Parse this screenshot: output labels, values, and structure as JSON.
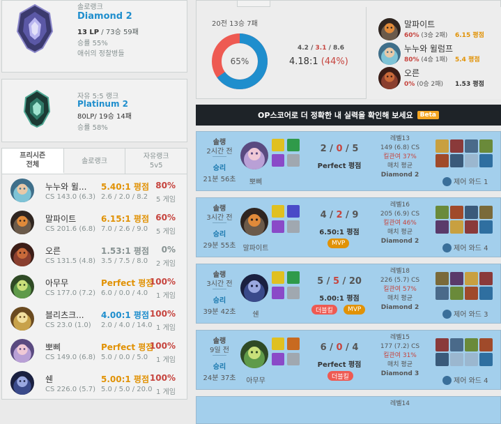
{
  "solo_rank": {
    "queue": "솔로랭크",
    "tier": "Diamond 2",
    "lp": "13 LP",
    "record": "/ 73승 59패",
    "winrate": "승률 55%",
    "league": "애쉬의 정찰병들"
  },
  "flex_rank": {
    "queue": "자유 5:5 랭크",
    "tier": "Platinum 2",
    "record": "80LP/ 19승 14패",
    "winrate": "승률 58%"
  },
  "tabs": [
    {
      "label": "프리시즌\n전체"
    },
    {
      "label": "솔로랭크"
    },
    {
      "label": "자유랭크\n5v5"
    }
  ],
  "champions": [
    {
      "name": "누누와 윌...",
      "cs": "CS 143.0 (6.3)",
      "kda": "5.40:1 평점",
      "kda_detail": "2.6 / 2.0 / 8.2",
      "winrate": "80%",
      "games": "5 게임",
      "kda_color": "#e19205",
      "wr_color": "#c6443e"
    },
    {
      "name": "말파이트",
      "cs": "CS 201.6 (6.8)",
      "kda": "6.15:1 평점",
      "kda_detail": "7.0 / 2.6 / 9.0",
      "winrate": "60%",
      "games": "5 게임",
      "kda_color": "#e19205",
      "wr_color": "#c6443e"
    },
    {
      "name": "오른",
      "cs": "CS 131.5 (4.8)",
      "kda": "1.53:1 평점",
      "kda_detail": "3.5 / 7.5 / 8.0",
      "winrate": "0%",
      "games": "2 게임",
      "kda_color": "#879292",
      "wr_color": "#879292"
    },
    {
      "name": "아무무",
      "cs": "CS 177.0 (7.2)",
      "kda": "Perfect 평점",
      "kda_detail": "6.0 / 0.0 / 4.0",
      "winrate": "100%",
      "games": "1 게임",
      "kda_color": "#e19205",
      "wr_color": "#c6443e"
    },
    {
      "name": "블리츠크...",
      "cs": "CS 23.0 (1.0)",
      "kda": "4.00:1 평점",
      "kda_detail": "2.0 / 4.0 / 14.0",
      "winrate": "100%",
      "games": "1 게임",
      "kda_color": "#1f8ecd",
      "wr_color": "#c6443e"
    },
    {
      "name": "뽀삐",
      "cs": "CS 149.0 (6.8)",
      "kda": "Perfect 평점",
      "kda_detail": "5.0 / 0.0 / 5.0",
      "winrate": "100%",
      "games": "1 게임",
      "kda_color": "#e19205",
      "wr_color": "#c6443e"
    },
    {
      "name": "쉔",
      "cs": "CS 226.0 (5.7)",
      "kda": "5.00:1 평점",
      "kda_detail": "5.0 / 5.0 / 20.0",
      "winrate": "100%",
      "games": "1 게임",
      "kda_color": "#e19205",
      "wr_color": "#c6443e"
    }
  ],
  "summary": {
    "record": "20전 13승 7패",
    "winrate_pct": "65%",
    "winrate_value": 65,
    "kills": "4.2",
    "deaths": "3.1",
    "assists": "8.6",
    "kda_ratio": "4.18:1",
    "kill_participation": "(44%)"
  },
  "most_played": [
    {
      "name": "말파이트",
      "winrate": "60%",
      "record": "(3승 2패)",
      "kda": "6.15 평점",
      "kda_color": "#e19205"
    },
    {
      "name": "누누와 윌럼프",
      "winrate": "80%",
      "record": "(4승 1패)",
      "kda": "5.4 평점",
      "kda_color": "#e19205"
    },
    {
      "name": "오른",
      "winrate": "0%",
      "record": "(0승 2패)",
      "kda": "1.53 평점",
      "kda_color": "#333333"
    }
  ],
  "banner": {
    "text": "OP스코어로 더 정확한 내 실력을 확인해 보세요",
    "badge": "Beta"
  },
  "matches": [
    {
      "type": "솔랭",
      "time": "2시간 전",
      "result": "승리",
      "duration": "21분 56초",
      "champion": "뽀삐",
      "kda_k": "2",
      "kda_d": "0",
      "kda_a": "5",
      "ratio": "Perfect 평점",
      "badges": [],
      "level": "레벨13",
      "cs": "149 (6.8) CS",
      "kp": "킬관여 37%",
      "avg": "매치 평균",
      "rank": "Diamond 2",
      "ward": "제어 와드 1"
    },
    {
      "type": "솔랭",
      "time": "3시간 전",
      "result": "승리",
      "duration": "29분 55초",
      "champion": "말파이트",
      "kda_k": "4",
      "kda_d": "2",
      "kda_a": "9",
      "ratio": "6.50:1 평점",
      "badges": [
        "MVP"
      ],
      "level": "레벨16",
      "cs": "205 (6.9) CS",
      "kp": "킬관여 46%",
      "avg": "매치 평균",
      "rank": "Diamond 2",
      "ward": "제어 와드 4"
    },
    {
      "type": "솔랭",
      "time": "3시간 전",
      "result": "승리",
      "duration": "39분 42초",
      "champion": "쉔",
      "kda_k": "5",
      "kda_d": "5",
      "kda_a": "20",
      "ratio": "5.00:1 평점",
      "badges": [
        "더블킬",
        "MVP"
      ],
      "level": "레벨18",
      "cs": "226 (5.7) CS",
      "kp": "킬관여 57%",
      "avg": "매치 평균",
      "rank": "Diamond 2",
      "ward": "제어 와드 3"
    },
    {
      "type": "솔랭",
      "time": "9일 전",
      "result": "승리",
      "duration": "24분 37초",
      "champion": "아무무",
      "kda_k": "6",
      "kda_d": "0",
      "kda_a": "4",
      "ratio": "Perfect 평점",
      "badges": [
        "더블킬"
      ],
      "level": "레벨15",
      "cs": "177 (7.2) CS",
      "kp": "킬관여 31%",
      "avg": "매치 평균",
      "rank": "Diamond 3",
      "ward": "제어 와드 4"
    },
    {
      "level": "레벨14"
    }
  ],
  "colors": {
    "win_bg": "#a3cfec",
    "accent_blue": "#1f8ecd",
    "loss_red": "#c6443e",
    "gold": "#e19205",
    "chart_win": "#1f8ecd",
    "chart_loss": "#ee5a52"
  }
}
